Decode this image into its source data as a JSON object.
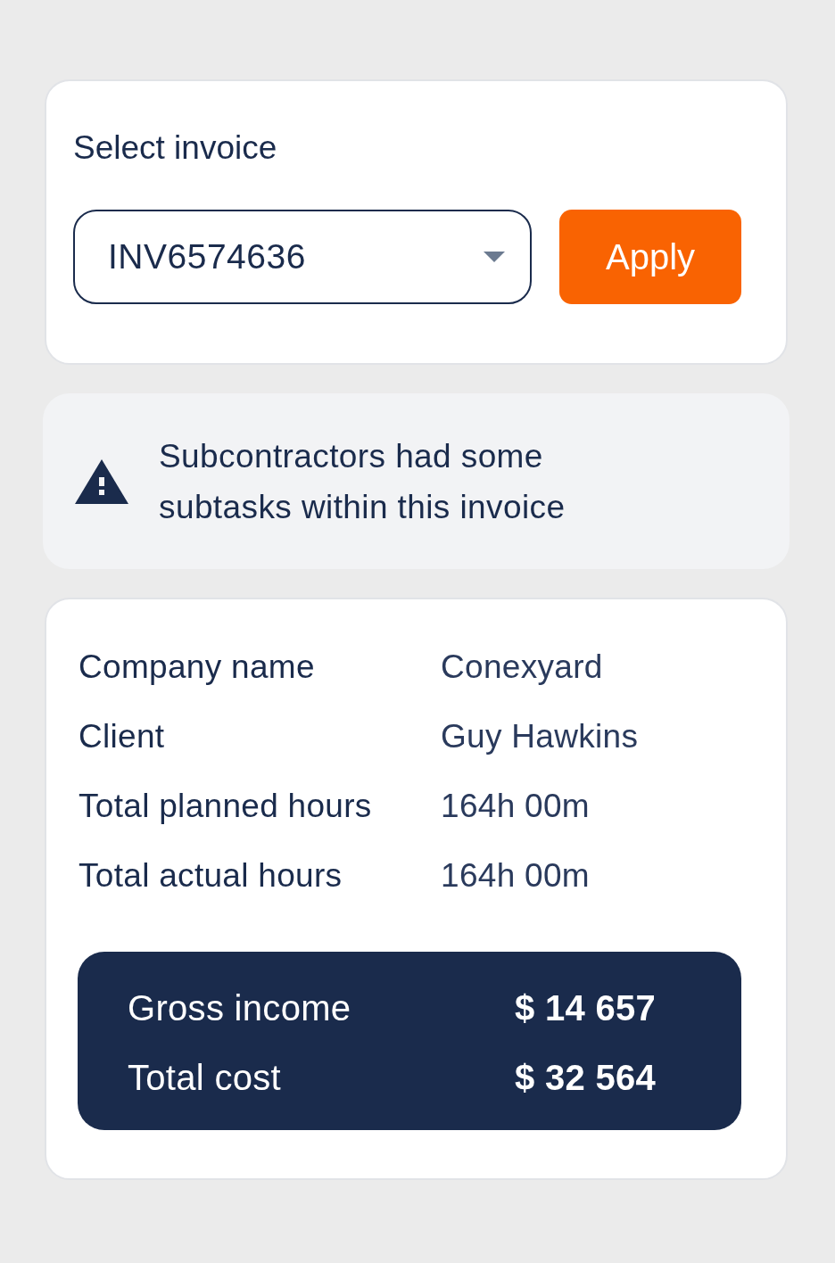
{
  "invoice_picker": {
    "label": "Select invoice",
    "select": {
      "value": "INV6574636"
    },
    "apply_button": "Apply"
  },
  "alert": {
    "kind": "warning",
    "message": "Subcontractors had some subtasks within this invoice"
  },
  "details": [
    {
      "label": "Company name",
      "value": "Conexyard"
    },
    {
      "label": "Client",
      "value": "Guy Hawkins"
    },
    {
      "label": "Total planned hours",
      "value": "164h 00m"
    },
    {
      "label": "Total actual hours",
      "value": "164h 00m"
    }
  ],
  "totals": [
    {
      "label": "Gross income",
      "value": "$ 14 657"
    },
    {
      "label": "Total cost",
      "value": "$ 32 564"
    }
  ]
}
